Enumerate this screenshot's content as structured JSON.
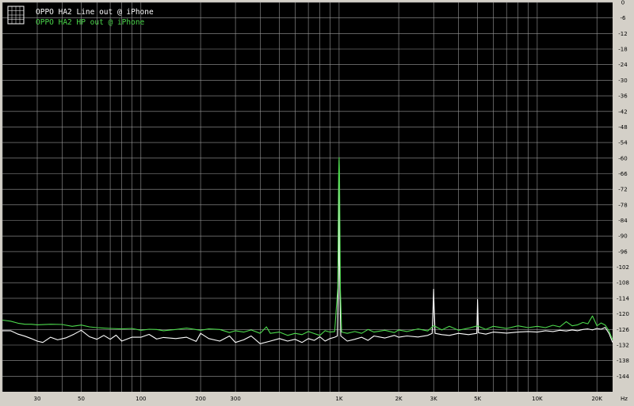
{
  "chart_data": {
    "type": "line",
    "title": "",
    "xlabel": "Hz",
    "ylabel": "",
    "x_scale": "log",
    "xlim": [
      20,
      24000
    ],
    "ylim": [
      -150,
      0
    ],
    "grid": true,
    "legend_position": "top-left",
    "background_color": "#000000",
    "grid_color": "#9a9a9a",
    "x_ticks": [
      30,
      50,
      100,
      200,
      300,
      1000,
      2000,
      3000,
      5000,
      10000,
      20000
    ],
    "x_tick_labels": [
      "30",
      "50",
      "100",
      "200",
      "300",
      "1K",
      "2K",
      "3K",
      "5K",
      "10K",
      "20K"
    ],
    "y_ticks": [
      0,
      -6,
      -12,
      -18,
      -24,
      -30,
      -36,
      -42,
      -48,
      -54,
      -60,
      -66,
      -72,
      -78,
      -84,
      -90,
      -96,
      -102,
      -108,
      -114,
      -120,
      -126,
      -132,
      -138,
      -144
    ],
    "y_tick_labels": [
      "0",
      "-6",
      "-12",
      "-18",
      "-24",
      "-30",
      "-36",
      "-42",
      "-48",
      "-54",
      "-60",
      "-66",
      "-72",
      "-78",
      "-84",
      "-90",
      "-96",
      "-102",
      "-108",
      "-114",
      "-120",
      "-126",
      "-132",
      "-138",
      "-144"
    ],
    "series": [
      {
        "name": "OPPO HA2 Line out @ iPhone",
        "color": "#ffffff",
        "values_xy": [
          [
            20,
            -126.5
          ],
          [
            22,
            -126.5
          ],
          [
            24,
            -127.8
          ],
          [
            26,
            -128.6
          ],
          [
            28,
            -129.5
          ],
          [
            30,
            -130.5
          ],
          [
            32,
            -131.0
          ],
          [
            35,
            -129.0
          ],
          [
            38,
            -130.0
          ],
          [
            42,
            -129.2
          ],
          [
            46,
            -127.8
          ],
          [
            50,
            -126.3
          ],
          [
            55,
            -128.8
          ],
          [
            60,
            -129.8
          ],
          [
            65,
            -128.3
          ],
          [
            70,
            -129.8
          ],
          [
            75,
            -128.2
          ],
          [
            80,
            -130.5
          ],
          [
            90,
            -129.0
          ],
          [
            100,
            -129.0
          ],
          [
            110,
            -127.9
          ],
          [
            120,
            -129.7
          ],
          [
            130,
            -129.1
          ],
          [
            150,
            -129.5
          ],
          [
            170,
            -129.0
          ],
          [
            190,
            -130.6
          ],
          [
            200,
            -127.5
          ],
          [
            220,
            -129.5
          ],
          [
            250,
            -130.5
          ],
          [
            280,
            -128.5
          ],
          [
            300,
            -131.0
          ],
          [
            330,
            -130.0
          ],
          [
            360,
            -128.5
          ],
          [
            400,
            -131.5
          ],
          [
            450,
            -130.5
          ],
          [
            500,
            -129.5
          ],
          [
            550,
            -130.5
          ],
          [
            600,
            -129.8
          ],
          [
            650,
            -131.0
          ],
          [
            700,
            -129.5
          ],
          [
            750,
            -130.2
          ],
          [
            800,
            -128.8
          ],
          [
            850,
            -130.5
          ],
          [
            900,
            -129.5
          ],
          [
            950,
            -129.0
          ],
          [
            980,
            -128.5
          ],
          [
            995,
            -100
          ],
          [
            1000,
            -60.8
          ],
          [
            1005,
            -100
          ],
          [
            1020,
            -128.5
          ],
          [
            1100,
            -130.5
          ],
          [
            1200,
            -129.8
          ],
          [
            1300,
            -129.0
          ],
          [
            1400,
            -130.2
          ],
          [
            1500,
            -128.5
          ],
          [
            1700,
            -129.3
          ],
          [
            1900,
            -128.3
          ],
          [
            2000,
            -129.0
          ],
          [
            2200,
            -128.5
          ],
          [
            2500,
            -128.9
          ],
          [
            2800,
            -128.3
          ],
          [
            2950,
            -127.5
          ],
          [
            2990,
            -114.6
          ],
          [
            3000,
            -110.5
          ],
          [
            3010,
            -114.6
          ],
          [
            3050,
            -127.5
          ],
          [
            3300,
            -128.0
          ],
          [
            3600,
            -128.3
          ],
          [
            4000,
            -127.5
          ],
          [
            4500,
            -128.0
          ],
          [
            4950,
            -127.5
          ],
          [
            4990,
            -118.0
          ],
          [
            5000,
            -114.5
          ],
          [
            5010,
            -118.0
          ],
          [
            5050,
            -127.3
          ],
          [
            5500,
            -127.8
          ],
          [
            6000,
            -127.0
          ],
          [
            7000,
            -127.4
          ],
          [
            8000,
            -127.0
          ],
          [
            9000,
            -126.8
          ],
          [
            10000,
            -127.0
          ],
          [
            11000,
            -126.5
          ],
          [
            12000,
            -126.8
          ],
          [
            13000,
            -126.3
          ],
          [
            14000,
            -126.6
          ],
          [
            15000,
            -126.2
          ],
          [
            16000,
            -126.5
          ],
          [
            17000,
            -126.0
          ],
          [
            18000,
            -125.8
          ],
          [
            19000,
            -126.2
          ],
          [
            20000,
            -125.6
          ],
          [
            21000,
            -125.9
          ],
          [
            22000,
            -125.2
          ],
          [
            23000,
            -127.5
          ],
          [
            24000,
            -131.0
          ]
        ]
      },
      {
        "name": "OPPO HA2 HP out @ iPhone",
        "color": "#4cd94c",
        "values_xy": [
          [
            20,
            -122.4
          ],
          [
            22,
            -122.8
          ],
          [
            24,
            -123.6
          ],
          [
            26,
            -124.0
          ],
          [
            28,
            -124.0
          ],
          [
            30,
            -124.2
          ],
          [
            35,
            -124.0
          ],
          [
            40,
            -124.1
          ],
          [
            45,
            -124.8
          ],
          [
            50,
            -124.3
          ],
          [
            55,
            -125.0
          ],
          [
            60,
            -125.3
          ],
          [
            70,
            -125.6
          ],
          [
            80,
            -125.8
          ],
          [
            90,
            -125.6
          ],
          [
            100,
            -126.3
          ],
          [
            110,
            -125.9
          ],
          [
            120,
            -126.0
          ],
          [
            130,
            -126.5
          ],
          [
            150,
            -126.0
          ],
          [
            170,
            -125.5
          ],
          [
            200,
            -126.3
          ],
          [
            220,
            -125.8
          ],
          [
            250,
            -126.0
          ],
          [
            280,
            -127.2
          ],
          [
            300,
            -126.5
          ],
          [
            330,
            -127.0
          ],
          [
            360,
            -126.2
          ],
          [
            400,
            -127.5
          ],
          [
            430,
            -125.0
          ],
          [
            450,
            -127.5
          ],
          [
            500,
            -127.0
          ],
          [
            550,
            -128.3
          ],
          [
            600,
            -127.5
          ],
          [
            650,
            -128.0
          ],
          [
            700,
            -126.8
          ],
          [
            750,
            -127.6
          ],
          [
            800,
            -128.3
          ],
          [
            850,
            -126.5
          ],
          [
            900,
            -127.0
          ],
          [
            950,
            -126.8
          ],
          [
            985,
            -110
          ],
          [
            995,
            -66
          ],
          [
            1000,
            -59.8
          ],
          [
            1005,
            -66
          ],
          [
            1015,
            -110
          ],
          [
            1030,
            -127.0
          ],
          [
            1100,
            -127.5
          ],
          [
            1200,
            -126.8
          ],
          [
            1300,
            -127.5
          ],
          [
            1400,
            -126.0
          ],
          [
            1500,
            -127.0
          ],
          [
            1700,
            -126.3
          ],
          [
            1900,
            -127.2
          ],
          [
            2000,
            -126.2
          ],
          [
            2200,
            -126.8
          ],
          [
            2500,
            -125.8
          ],
          [
            2800,
            -126.6
          ],
          [
            3000,
            -124.5
          ],
          [
            3300,
            -126.2
          ],
          [
            3600,
            -124.8
          ],
          [
            4000,
            -126.3
          ],
          [
            4500,
            -125.5
          ],
          [
            5000,
            -124.6
          ],
          [
            5500,
            -126.0
          ],
          [
            6000,
            -124.8
          ],
          [
            7000,
            -125.6
          ],
          [
            8000,
            -124.6
          ],
          [
            9000,
            -125.3
          ],
          [
            10000,
            -124.8
          ],
          [
            11000,
            -125.3
          ],
          [
            12000,
            -124.4
          ],
          [
            13000,
            -125.0
          ],
          [
            14000,
            -123.0
          ],
          [
            15000,
            -124.6
          ],
          [
            16000,
            -124.2
          ],
          [
            17000,
            -123.3
          ],
          [
            18000,
            -123.8
          ],
          [
            19000,
            -120.8
          ],
          [
            20000,
            -124.6
          ],
          [
            21000,
            -123.5
          ],
          [
            22000,
            -124.3
          ],
          [
            23000,
            -126.5
          ],
          [
            24000,
            -130.0
          ]
        ]
      }
    ]
  }
}
